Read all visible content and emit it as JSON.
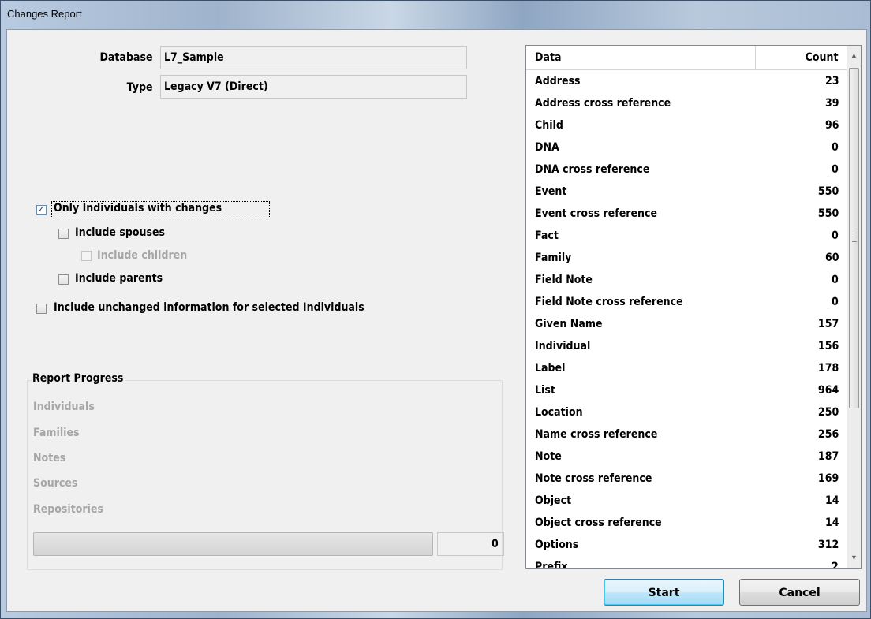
{
  "window": {
    "title": "Changes Report"
  },
  "database": {
    "label": "Database",
    "value": "L7_Sample"
  },
  "type": {
    "label": "Type",
    "value": "Legacy V7 (Direct)"
  },
  "options": {
    "only_individuals": {
      "label": "Only Individuals with changes",
      "checked": true
    },
    "include_spouses": {
      "label": "Include spouses",
      "checked": false
    },
    "include_children": {
      "label": "Include children",
      "checked": false,
      "enabled": false
    },
    "include_parents": {
      "label": "Include parents",
      "checked": false
    },
    "include_unchanged": {
      "label": "Include unchanged information for selected Individuals",
      "checked": false
    }
  },
  "progress": {
    "title": "Report Progress",
    "items": [
      "Individuals",
      "Families",
      "Notes",
      "Sources",
      "Repositories"
    ],
    "bar_fraction": 0,
    "value": "0"
  },
  "table": {
    "headers": {
      "data": "Data",
      "count": "Count"
    },
    "rows": [
      {
        "name": "Address",
        "count": "23"
      },
      {
        "name": "Address cross reference",
        "count": "39"
      },
      {
        "name": "Child",
        "count": "96"
      },
      {
        "name": "DNA",
        "count": "0"
      },
      {
        "name": "DNA cross reference",
        "count": "0"
      },
      {
        "name": "Event",
        "count": "550"
      },
      {
        "name": "Event cross reference",
        "count": "550"
      },
      {
        "name": "Fact",
        "count": "0"
      },
      {
        "name": "Family",
        "count": "60"
      },
      {
        "name": "Field Note",
        "count": "0"
      },
      {
        "name": "Field Note cross reference",
        "count": "0"
      },
      {
        "name": "Given Name",
        "count": "157"
      },
      {
        "name": "Individual",
        "count": "156"
      },
      {
        "name": "Label",
        "count": "178"
      },
      {
        "name": "List",
        "count": "964"
      },
      {
        "name": "Location",
        "count": "250"
      },
      {
        "name": "Name cross reference",
        "count": "256"
      },
      {
        "name": "Note",
        "count": "187"
      },
      {
        "name": "Note cross reference",
        "count": "169"
      },
      {
        "name": "Object",
        "count": "14"
      },
      {
        "name": "Object cross reference",
        "count": "14"
      },
      {
        "name": "Options",
        "count": "312"
      },
      {
        "name": "Prefix",
        "count": "2"
      }
    ]
  },
  "buttons": {
    "start": "Start",
    "cancel": "Cancel"
  },
  "icons": {
    "scroll_up": "chevron-up-icon",
    "scroll_down": "chevron-down-icon",
    "check": "checkmark-icon"
  }
}
